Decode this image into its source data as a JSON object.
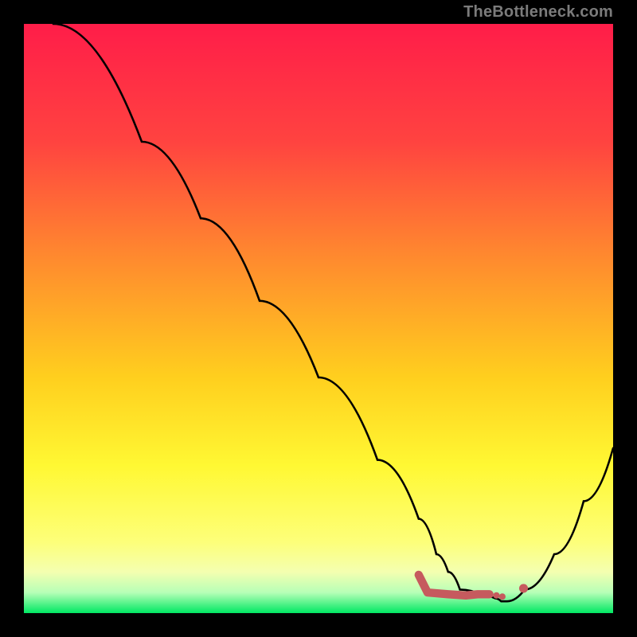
{
  "watermark": "TheBottleneck.com",
  "gradient_stops": [
    {
      "offset": 0,
      "color": "#ff1d49"
    },
    {
      "offset": 20,
      "color": "#ff4340"
    },
    {
      "offset": 40,
      "color": "#ff8b2e"
    },
    {
      "offset": 60,
      "color": "#ffcf1e"
    },
    {
      "offset": 75,
      "color": "#fff833"
    },
    {
      "offset": 88,
      "color": "#fdff7a"
    },
    {
      "offset": 93,
      "color": "#f4ffb0"
    },
    {
      "offset": 96.5,
      "color": "#b7ffb7"
    },
    {
      "offset": 100,
      "color": "#00e863"
    }
  ],
  "accent_color": "#c65a5e",
  "curve_color": "#000000",
  "chart_data": {
    "type": "line",
    "title": "",
    "xlabel": "",
    "ylabel": "",
    "xlim": [
      0,
      100
    ],
    "ylim": [
      0,
      100
    ],
    "series": [
      {
        "name": "curve",
        "x": [
          0,
          5,
          20,
          30,
          40,
          50,
          60,
          67,
          70,
          72,
          74,
          78,
          80,
          81,
          82,
          85,
          90,
          95,
          100
        ],
        "y": [
          105,
          100,
          80,
          67,
          53,
          40,
          26,
          16,
          10,
          7,
          4,
          3,
          2.5,
          2,
          2,
          4,
          10,
          19,
          28
        ]
      }
    ],
    "markers": [
      {
        "name": "segment",
        "shape": "path",
        "x": [
          67,
          68.5,
          72,
          75,
          77,
          79
        ],
        "y": [
          6.5,
          3.5,
          3.2,
          3,
          3.2,
          3.2
        ]
      },
      {
        "name": "dot",
        "shape": "circle",
        "x": 80.2,
        "y": 3.0,
        "r": 0.55
      },
      {
        "name": "dot",
        "shape": "circle",
        "x": 81.2,
        "y": 2.8,
        "r": 0.55
      },
      {
        "name": "dot",
        "shape": "circle",
        "x": 84.8,
        "y": 4.2,
        "r": 0.75
      }
    ]
  }
}
